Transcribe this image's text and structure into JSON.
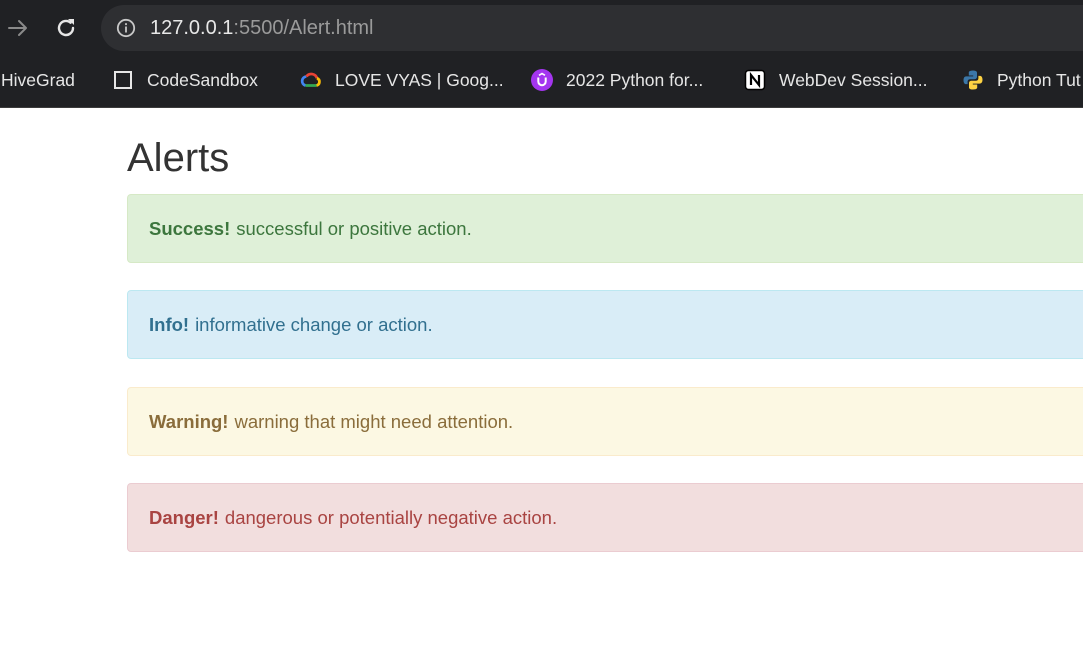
{
  "browser": {
    "url_host": "127.0.0.1",
    "url_rest": ":5500/Alert.html",
    "bookmarks": [
      {
        "label": "HiveGrad",
        "icon": "none"
      },
      {
        "label": "CodeSandbox",
        "icon": "codesandbox-icon"
      },
      {
        "label": "LOVE VYAS | Goog...",
        "icon": "google-cloud-icon"
      },
      {
        "label": "2022 Python for...",
        "icon": "udemy-icon"
      },
      {
        "label": "WebDev Session...",
        "icon": "notion-icon"
      },
      {
        "label": "Python Tut",
        "icon": "python-icon"
      }
    ]
  },
  "page": {
    "title": "Alerts",
    "alerts": [
      {
        "type": "success",
        "strong": "Success!",
        "text": "successful or positive action.",
        "color": "#3c763d",
        "background": "#dff0d8"
      },
      {
        "type": "info",
        "strong": "Info!",
        "text": "informative change or action.",
        "color": "#31708f",
        "background": "#d9edf7"
      },
      {
        "type": "warning",
        "strong": "Warning!",
        "text": "warning that might need attention.",
        "color": "#8a6d3b",
        "background": "#fcf8e3"
      },
      {
        "type": "danger",
        "strong": "Danger!",
        "text": "dangerous or potentially negative action.",
        "color": "#a94442",
        "background": "#f2dede"
      }
    ]
  },
  "colors": {
    "chrome_background": "#202124",
    "omnibox_background": "#2e2f32",
    "title_text": "#333333"
  }
}
